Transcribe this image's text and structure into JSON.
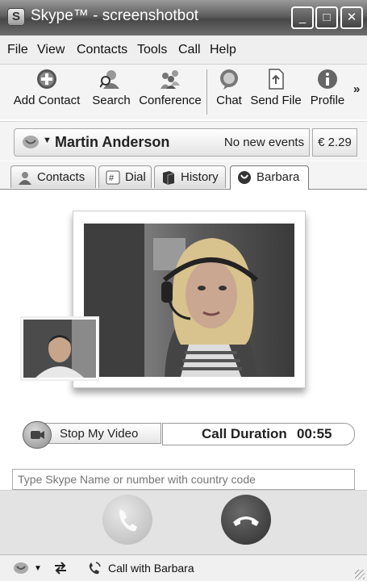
{
  "window": {
    "title": "Skype™ - screenshotbot",
    "app_icon_letter": "S",
    "min": "_",
    "max": "□",
    "close": "✕"
  },
  "menu": [
    "File",
    "View",
    "Contacts",
    "Tools",
    "Call",
    "Help"
  ],
  "toolbar": {
    "add_contact": "Add Contact",
    "search": "Search",
    "conference": "Conference",
    "chat": "Chat",
    "send_file": "Send File",
    "profile": "Profile",
    "more": "»"
  },
  "status": {
    "user_name": "Martin Anderson",
    "events": "No new events",
    "credit": "€ 2.29"
  },
  "tabs": [
    "Contacts",
    "Dial",
    "History",
    "Barbara"
  ],
  "call": {
    "stop_video": "Stop My Video",
    "duration_label": "Call Duration",
    "duration_value": "00:55"
  },
  "dial": {
    "placeholder": "Type Skype Name or number with country code"
  },
  "statusbar": {
    "call_with": "Call with Barbara"
  }
}
